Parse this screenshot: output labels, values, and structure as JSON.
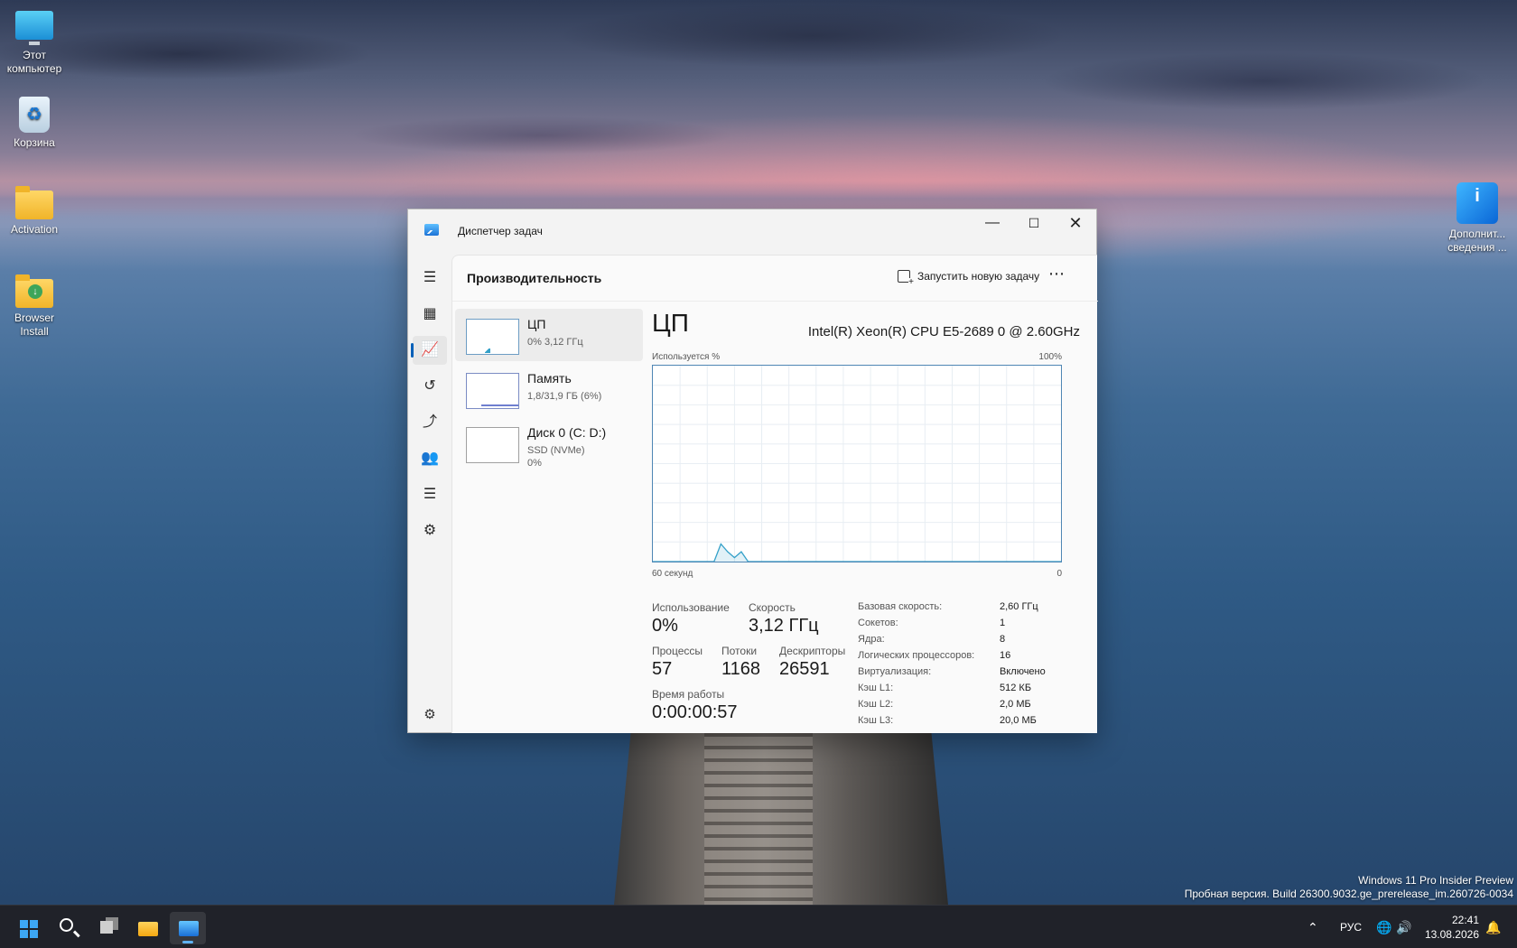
{
  "desktop": {
    "icons": [
      {
        "label": "Этот компьютер",
        "icon": "this-pc-icon"
      },
      {
        "label": "Корзина",
        "icon": "recycle-bin-icon"
      },
      {
        "label": "Activation",
        "icon": "folder-icon"
      },
      {
        "label": "Browser Install",
        "icon": "folder-icon"
      },
      {
        "label": "Дополнит... сведения ...",
        "icon": "info-app-icon"
      }
    ],
    "watermark": {
      "line1": "Windows 11 Pro Insider Preview",
      "line2": "Пробная версия. Build 26300.9032.ge_prerelease_im.260726-0034"
    }
  },
  "window": {
    "title": "Диспетчер задач",
    "controls": {
      "minimize": "—",
      "maximize": "☐",
      "close": "✕"
    },
    "nav": [
      {
        "name": "menu",
        "glyph": "☰"
      },
      {
        "name": "processes",
        "glyph": "▦"
      },
      {
        "name": "performance",
        "glyph": "📈"
      },
      {
        "name": "app-history",
        "glyph": "↺"
      },
      {
        "name": "startup-apps",
        "glyph": "⤴"
      },
      {
        "name": "users",
        "glyph": "👥"
      },
      {
        "name": "details",
        "glyph": "☰"
      },
      {
        "name": "services",
        "glyph": "⚙"
      }
    ],
    "settings_glyph": "⚙",
    "header": {
      "title": "Производительность",
      "run_task": "Запустить новую задачу",
      "more": "⋯"
    },
    "perf_items": [
      {
        "name": "ЦП",
        "sub1": "0%  3,12 ГГц",
        "sub2": ""
      },
      {
        "name": "Память",
        "sub1": "1,8/31,9 ГБ (6%)",
        "sub2": ""
      },
      {
        "name": "Диск 0 (C: D:)",
        "sub1": "SSD (NVMe)",
        "sub2": "0%"
      }
    ],
    "detail": {
      "title": "ЦП",
      "model": "Intel(R) Xeon(R) CPU E5-2689 0 @ 2.60GHz",
      "graph_label_left": "Используется %",
      "graph_label_right": "100%",
      "graph_foot_left": "60 секунд",
      "graph_foot_right": "0",
      "utilization_label": "Использование",
      "utilization": "0%",
      "speed_label": "Скорость",
      "speed": "3,12 ГГц",
      "processes_label": "Процессы",
      "processes": "57",
      "threads_label": "Потоки",
      "threads": "1168",
      "handles_label": "Дескрипторы",
      "handles": "26591",
      "uptime_label": "Время работы",
      "uptime": "0:00:00:57",
      "specs": [
        {
          "k": "Базовая скорость:",
          "v": "2,60 ГГц"
        },
        {
          "k": "Сокетов:",
          "v": "1"
        },
        {
          "k": "Ядра:",
          "v": "8"
        },
        {
          "k": "Логических процессоров:",
          "v": "16"
        },
        {
          "k": "Виртуализация:",
          "v": "Включено"
        },
        {
          "k": "Кэш L1:",
          "v": "512 КБ"
        },
        {
          "k": "Кэш L2:",
          "v": "2,0 МБ"
        },
        {
          "k": "Кэш L3:",
          "v": "20,0 МБ"
        }
      ]
    }
  },
  "chart_data": {
    "type": "area",
    "ylim": [
      0,
      100
    ],
    "xlim": [
      60,
      0
    ],
    "x": [
      60,
      51,
      50,
      49,
      48,
      47,
      46,
      0
    ],
    "values": [
      0,
      0,
      9,
      5,
      2,
      5,
      0,
      0
    ],
    "accent": "#35a1c9"
  },
  "taskbar": {
    "items": [
      "start",
      "search",
      "task-view",
      "file-explorer",
      "task-manager"
    ],
    "tray": {
      "chevron": "⌃",
      "lang": "РУС",
      "network": "🌐",
      "volume": "🔊"
    },
    "time": "22:41",
    "date": "13.08.2026"
  }
}
